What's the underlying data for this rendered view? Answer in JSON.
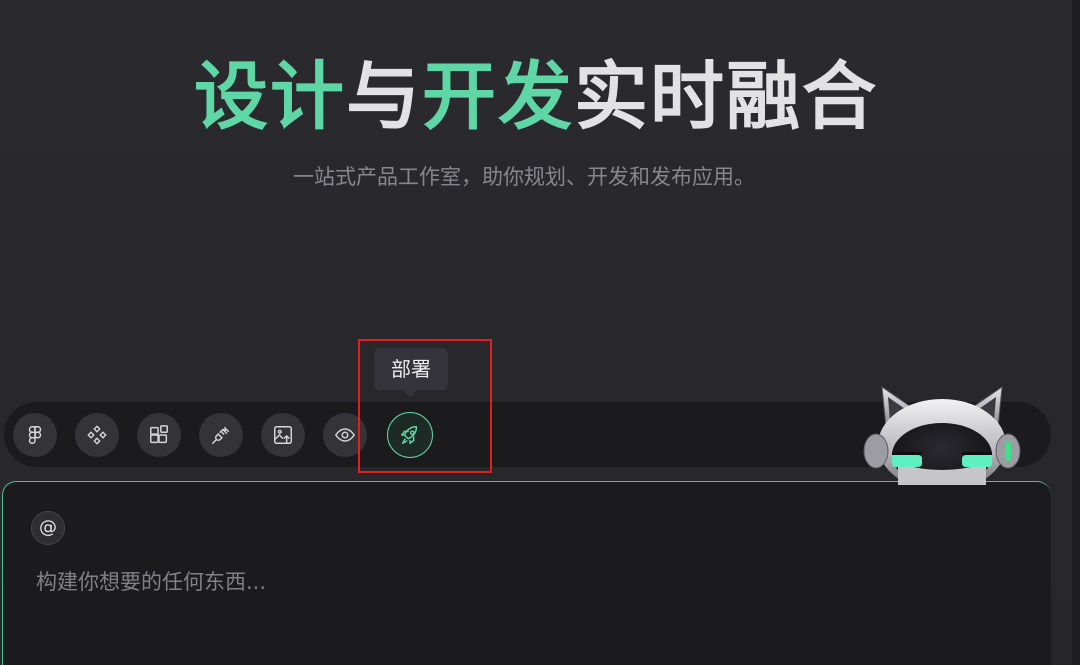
{
  "hero": {
    "title_part1": "设计",
    "title_part2": "与",
    "title_part3": "开发",
    "title_part4": "实时融合",
    "subtitle": "一站式产品工作室，助你规划、开发和发布应用。"
  },
  "toolbar": {
    "tools": [
      {
        "icon": "figma-icon"
      },
      {
        "icon": "components-icon"
      },
      {
        "icon": "apps-grid-icon"
      },
      {
        "icon": "plug-icon"
      },
      {
        "icon": "image-upload-icon"
      },
      {
        "icon": "eye-icon"
      },
      {
        "icon": "rocket-icon",
        "active": true
      }
    ],
    "tooltip": "部署"
  },
  "composer": {
    "mention_symbol": "@",
    "placeholder": "构建你想要的任何东西..."
  },
  "colors": {
    "accent": "#5fd6a6",
    "highlight": "#e21f1f",
    "background": "#28282c"
  }
}
